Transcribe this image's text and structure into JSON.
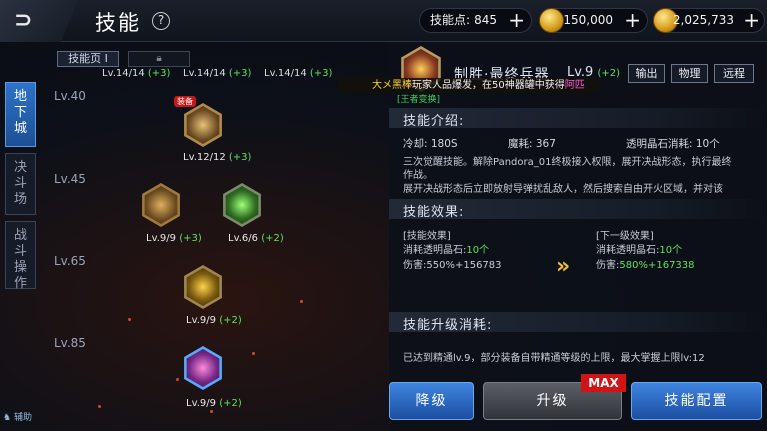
{
  "header": {
    "title": "技能",
    "help_icon": "?",
    "skill_points": {
      "label": "技能点:",
      "value": "845"
    },
    "gold": {
      "value": "150,000"
    },
    "currency2": {
      "value": "2,025,733"
    }
  },
  "left_tabs": [
    {
      "label": "地下城",
      "active": true
    },
    {
      "label": "决斗场",
      "active": false
    },
    {
      "label": "战斗操作",
      "active": false
    }
  ],
  "assist_label": "辅助",
  "page_tabs": {
    "active": "技能页 I"
  },
  "level_labels": [
    "Lv.40",
    "Lv.45",
    "Lv.65",
    "Lv.85"
  ],
  "top_counts": [
    {
      "base": "Lv.14/14",
      "bonus": "(+3)"
    },
    {
      "base": "Lv.14/14",
      "bonus": "(+3)"
    },
    {
      "base": "Lv.14/14",
      "bonus": "(+3)"
    }
  ],
  "skills": [
    {
      "level": "Lv.12/12",
      "bonus": "(+3)",
      "badge": "装备",
      "icon": "crossed-blades-icon"
    },
    {
      "level": "Lv.9/9",
      "bonus": "(+3)",
      "icon": "cannon-icon"
    },
    {
      "level": "Lv.6/6",
      "bonus": "(+2)",
      "icon": "green-tech-icon"
    },
    {
      "level": "Lv.9/9",
      "bonus": "(+2)",
      "icon": "gold-weapon-icon"
    },
    {
      "level": "Lv.9/9",
      "bonus": "(+2)",
      "icon": "purple-mech-icon"
    }
  ],
  "detail": {
    "name": "制胜·最终兵器",
    "level": "Lv.9",
    "level_bonus": "(+2)",
    "tags": [
      "输出",
      "物理",
      "远程"
    ],
    "marquee": {
      "prefix": "大メ黑棒",
      "mid": "玩家人品爆发，在50神器罐中获得",
      "suffix": "阿匹",
      "sub": "[王者变换]"
    },
    "intro_title": "技能介绍:",
    "cooldown": "冷却: 180S",
    "mana": "魔耗: 367",
    "crystal": "透明晶石消耗: 10个",
    "desc1": "三次觉醒技能。解除Pandora_01终极接入权限，展开决战形态，执行最终",
    "desc2": "作战。",
    "desc3": "展开决战形态后立即放射导弹扰乱敌人，然后搜索自由开火区域，并对该",
    "effect_title": "技能效果:",
    "cur": {
      "head": "[技能效果]",
      "cost": "消耗透明晶石:",
      "cost_val": "10个",
      "dmg": "伤害:",
      "dmg_val": "550%+156783"
    },
    "next": {
      "head": "[下一级效果]",
      "cost": "消耗透明晶石:",
      "cost_val": "10个",
      "dmg": "伤害:",
      "dmg_val": "580%+167338"
    },
    "upgrade_title": "技能升级消耗:",
    "upgrade_note": "已达到精通lv.9，部分装备自带精通等级的上限，最大掌握上限lv:12"
  },
  "buttons": {
    "downgrade": "降级",
    "upgrade": "升级",
    "config": "技能配置",
    "max": "MAX"
  }
}
